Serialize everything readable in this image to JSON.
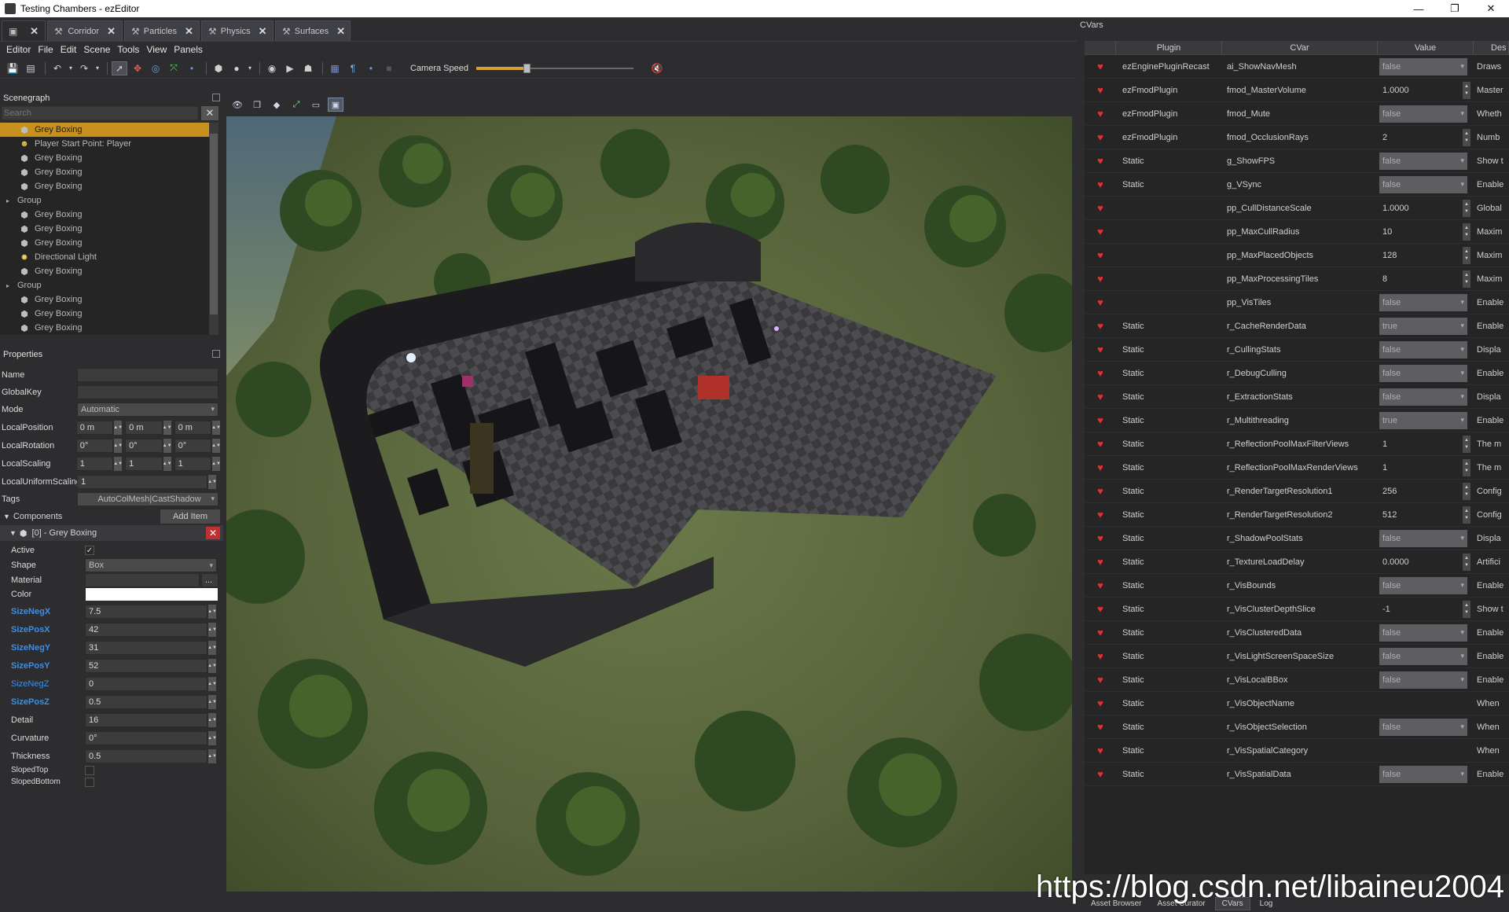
{
  "window": {
    "title": "Testing Chambers - ezEditor",
    "controls": [
      "—",
      "❐",
      "✕"
    ]
  },
  "doc_tabs": [
    {
      "label": "",
      "close": "✕"
    },
    {
      "label": "Corridor",
      "close": "✕"
    },
    {
      "label": "Particles",
      "close": "✕"
    },
    {
      "label": "Physics",
      "close": "✕"
    },
    {
      "label": "Surfaces",
      "close": "✕"
    }
  ],
  "menu": [
    "Editor",
    "File",
    "Edit",
    "Scene",
    "Tools",
    "View",
    "Panels"
  ],
  "toolbar": {
    "camera_speed_label": "Camera Speed",
    "camera_speed_level": 0.32
  },
  "scenegraph": {
    "title": "Scenegraph",
    "search_placeholder": "Search",
    "items": [
      {
        "label": "Grey Boxing",
        "icon": "box-icon",
        "selected": true,
        "indent": 1
      },
      {
        "label": "Player Start Point: Player",
        "icon": "player-icon",
        "indent": 1
      },
      {
        "label": "Grey Boxing",
        "icon": "box-icon",
        "indent": 1
      },
      {
        "label": "Grey Boxing",
        "icon": "box-icon",
        "indent": 1
      },
      {
        "label": "Grey Boxing",
        "icon": "box-icon",
        "indent": 1
      },
      {
        "label": "Group",
        "icon": "",
        "indent": 0,
        "expandable": true
      },
      {
        "label": "Grey Boxing",
        "icon": "box-icon",
        "indent": 1
      },
      {
        "label": "Grey Boxing",
        "icon": "box-icon",
        "indent": 1
      },
      {
        "label": "Grey Boxing",
        "icon": "box-icon",
        "indent": 1
      },
      {
        "label": "Directional Light",
        "icon": "sun-icon",
        "indent": 1
      },
      {
        "label": "Grey Boxing",
        "icon": "box-icon",
        "indent": 1
      },
      {
        "label": "Group",
        "icon": "",
        "indent": 0,
        "expandable": true
      },
      {
        "label": "Grey Boxing",
        "icon": "box-icon",
        "indent": 1
      },
      {
        "label": "Grey Boxing",
        "icon": "box-icon",
        "indent": 1
      },
      {
        "label": "Grey Boxing",
        "icon": "box-icon",
        "indent": 1
      }
    ]
  },
  "properties": {
    "title": "Properties",
    "name_label": "Name",
    "name_value": "",
    "globalkey_label": "GlobalKey",
    "globalkey_value": "",
    "mode_label": "Mode",
    "mode_value": "Automatic",
    "localposition_label": "LocalPosition",
    "localposition": [
      "0 m",
      "0 m",
      "0 m"
    ],
    "localrotation_label": "LocalRotation",
    "localrotation": [
      "0°",
      "0°",
      "0°"
    ],
    "localscaling_label": "LocalScaling",
    "localscaling": [
      "1",
      "1",
      "1"
    ],
    "uniformscaling_label": "LocalUniformScaling",
    "uniformscaling_value": "1",
    "tags_label": "Tags",
    "tags_value": "AutoColMesh|CastShadow",
    "components_label": "Components",
    "add_item": "Add Item",
    "component_title": "[0] - Grey Boxing",
    "active_label": "Active",
    "active_check": "✓",
    "shape_label": "Shape",
    "shape_value": "Box",
    "material_label": "Material",
    "material_value": "",
    "material_browse": "...",
    "color_label": "Color",
    "sizenegx_label": "SizeNegX",
    "sizenegx": "7.5",
    "sizeposx_label": "SizePosX",
    "sizeposx": "42",
    "sizenegy_label": "SizeNegY",
    "sizenegy": "31",
    "sizeposy_label": "SizePosY",
    "sizeposy": "52",
    "sizenegz_label": "SizeNegZ",
    "sizenegz": "0",
    "sizeposz_label": "SizePosZ",
    "sizeposz": "0.5",
    "detail_label": "Detail",
    "detail": "16",
    "curvature_label": "Curvature",
    "curvature": "0°",
    "thickness_label": "Thickness",
    "thickness": "0.5",
    "slopedtop_label": "SlopedTop",
    "slopedbottom_label": "SlopedBottom"
  },
  "cvars": {
    "title": "CVars",
    "headers": {
      "plugin": "Plugin",
      "cvar": "CVar",
      "value": "Value",
      "desc": "Des"
    },
    "rows": [
      {
        "plugin": "ezEnginePluginRecast",
        "name": "ai_ShowNavMesh",
        "value": "false",
        "kind": "combo",
        "desc": "Draws"
      },
      {
        "plugin": "ezFmodPlugin",
        "name": "fmod_MasterVolume",
        "value": "1.0000",
        "kind": "spin",
        "desc": "Master"
      },
      {
        "plugin": "ezFmodPlugin",
        "name": "fmod_Mute",
        "value": "false",
        "kind": "combo",
        "desc": "Wheth"
      },
      {
        "plugin": "ezFmodPlugin",
        "name": "fmod_OcclusionRays",
        "value": "2",
        "kind": "spin",
        "desc": "Numb"
      },
      {
        "plugin": "Static",
        "name": "g_ShowFPS",
        "value": "false",
        "kind": "combo",
        "desc": "Show t"
      },
      {
        "plugin": "Static",
        "name": "g_VSync",
        "value": "false",
        "kind": "combo",
        "desc": "Enable"
      },
      {
        "plugin": "",
        "name": "pp_CullDistanceScale",
        "value": "1.0000",
        "kind": "spin",
        "desc": "Global"
      },
      {
        "plugin": "",
        "name": "pp_MaxCullRadius",
        "value": "10",
        "kind": "spin",
        "desc": "Maxim"
      },
      {
        "plugin": "",
        "name": "pp_MaxPlacedObjects",
        "value": "128",
        "kind": "spin",
        "desc": "Maxim"
      },
      {
        "plugin": "",
        "name": "pp_MaxProcessingTiles",
        "value": "8",
        "kind": "spin",
        "desc": "Maxim"
      },
      {
        "plugin": "",
        "name": "pp_VisTiles",
        "value": "false",
        "kind": "combo",
        "desc": "Enable"
      },
      {
        "plugin": "Static",
        "name": "r_CacheRenderData",
        "value": "true",
        "kind": "combo",
        "desc": "Enable"
      },
      {
        "plugin": "Static",
        "name": "r_CullingStats",
        "value": "false",
        "kind": "combo",
        "desc": "Displa"
      },
      {
        "plugin": "Static",
        "name": "r_DebugCulling",
        "value": "false",
        "kind": "combo",
        "desc": "Enable"
      },
      {
        "plugin": "Static",
        "name": "r_ExtractionStats",
        "value": "false",
        "kind": "combo",
        "desc": "Displa"
      },
      {
        "plugin": "Static",
        "name": "r_Multithreading",
        "value": "true",
        "kind": "combo",
        "desc": "Enable"
      },
      {
        "plugin": "Static",
        "name": "r_ReflectionPoolMaxFilterViews",
        "value": "1",
        "kind": "spin",
        "desc": "The m"
      },
      {
        "plugin": "Static",
        "name": "r_ReflectionPoolMaxRenderViews",
        "value": "1",
        "kind": "spin",
        "desc": "The m"
      },
      {
        "plugin": "Static",
        "name": "r_RenderTargetResolution1",
        "value": "256",
        "kind": "spin",
        "desc": "Config"
      },
      {
        "plugin": "Static",
        "name": "r_RenderTargetResolution2",
        "value": "512",
        "kind": "spin",
        "desc": "Config"
      },
      {
        "plugin": "Static",
        "name": "r_ShadowPoolStats",
        "value": "false",
        "kind": "combo",
        "desc": "Displa"
      },
      {
        "plugin": "Static",
        "name": "r_TextureLoadDelay",
        "value": "0.0000",
        "kind": "spin",
        "desc": "Artifici"
      },
      {
        "plugin": "Static",
        "name": "r_VisBounds",
        "value": "false",
        "kind": "combo",
        "desc": "Enable"
      },
      {
        "plugin": "Static",
        "name": "r_VisClusterDepthSlice",
        "value": "-1",
        "kind": "spin",
        "desc": "Show t"
      },
      {
        "plugin": "Static",
        "name": "r_VisClusteredData",
        "value": "false",
        "kind": "combo",
        "desc": "Enable"
      },
      {
        "plugin": "Static",
        "name": "r_VisLightScreenSpaceSize",
        "value": "false",
        "kind": "combo",
        "desc": "Enable"
      },
      {
        "plugin": "Static",
        "name": "r_VisLocalBBox",
        "value": "false",
        "kind": "combo",
        "desc": "Enable"
      },
      {
        "plugin": "Static",
        "name": "r_VisObjectName",
        "value": "",
        "kind": "text",
        "desc": "When"
      },
      {
        "plugin": "Static",
        "name": "r_VisObjectSelection",
        "value": "false",
        "kind": "combo",
        "desc": "When"
      },
      {
        "plugin": "Static",
        "name": "r_VisSpatialCategory",
        "value": "",
        "kind": "text",
        "desc": "When"
      },
      {
        "plugin": "Static",
        "name": "r_VisSpatialData",
        "value": "false",
        "kind": "combo",
        "desc": "Enable"
      }
    ]
  },
  "bottom_tabs": [
    "Asset Browser",
    "Asset Curator",
    "CVars",
    "Log"
  ],
  "watermark": "https://blog.csdn.net/libaineu2004",
  "colors": {
    "accent": "#c8901f",
    "cvar_flag": "#e03030",
    "bold_prop": "#3b8fe8"
  }
}
